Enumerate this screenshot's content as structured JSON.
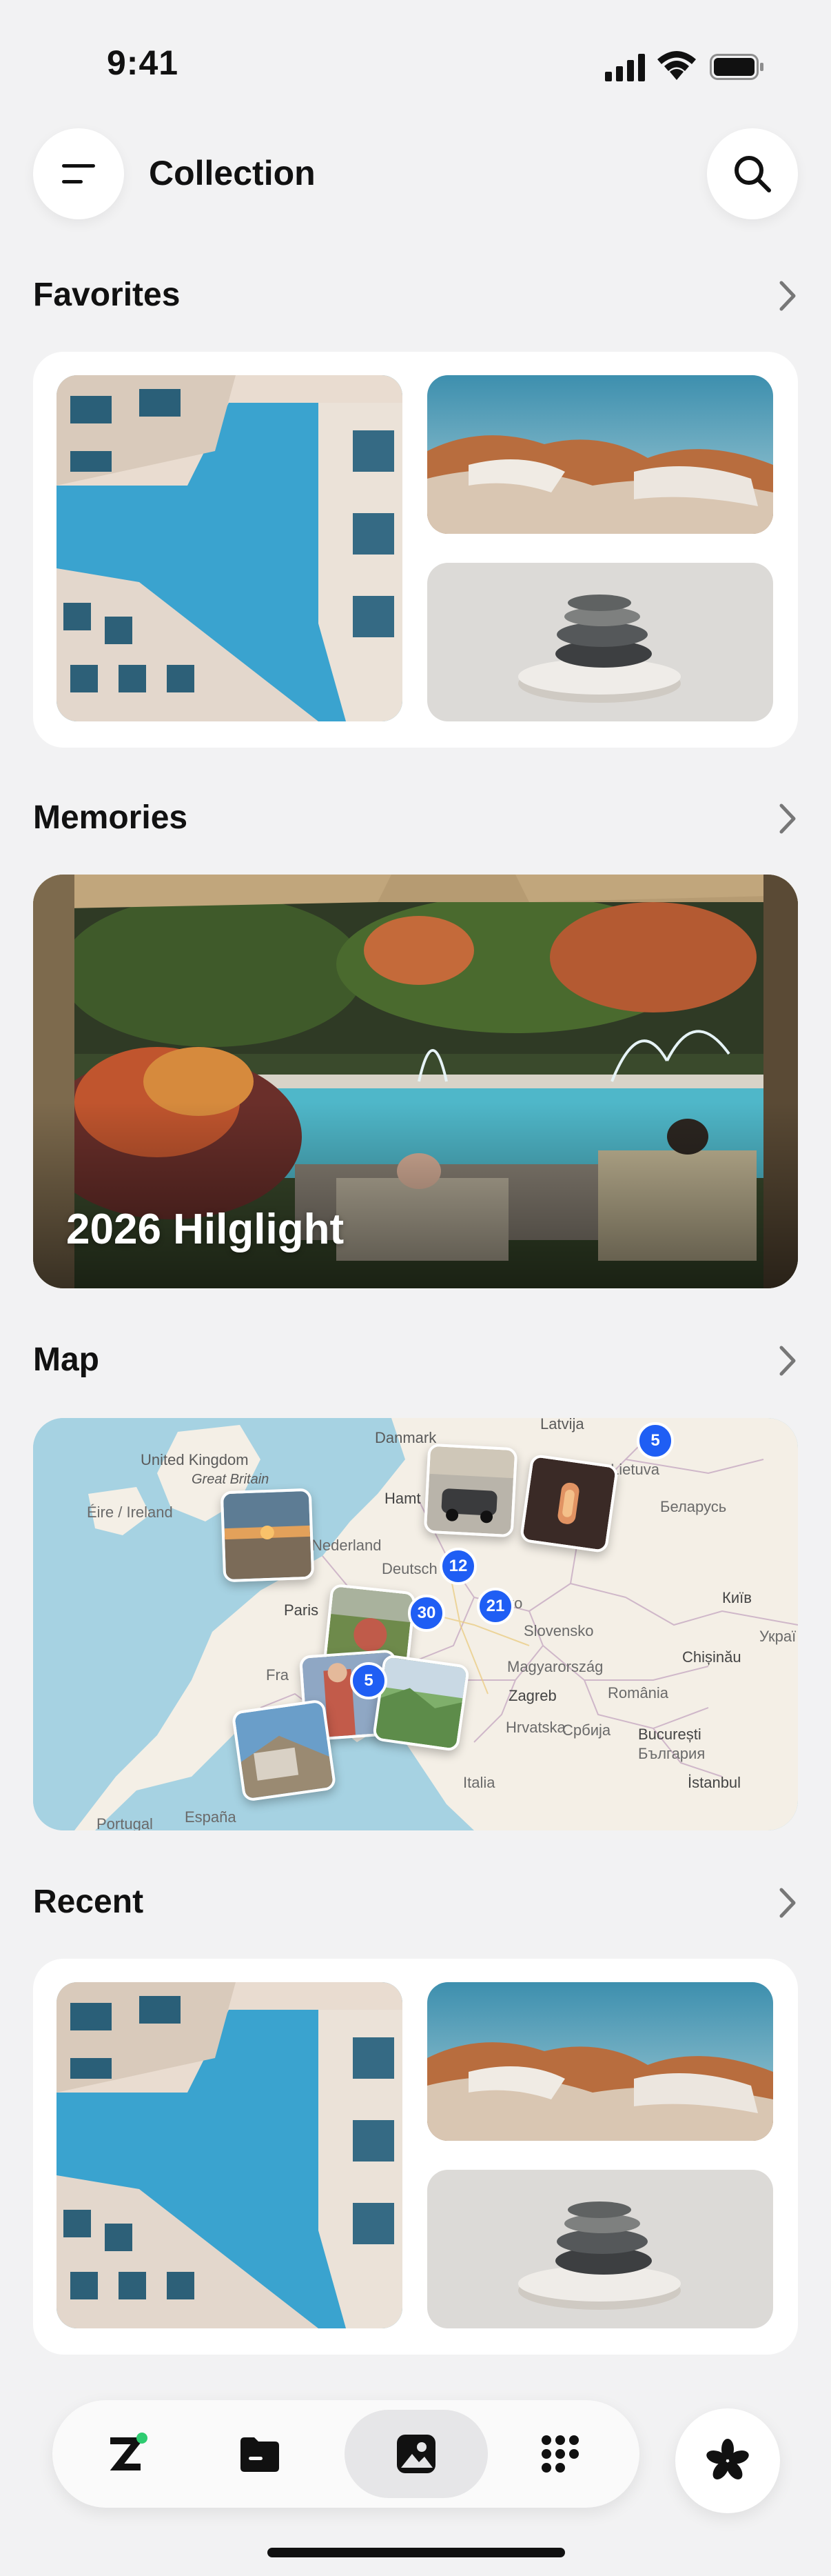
{
  "status_bar": {
    "time": "9:41"
  },
  "header": {
    "title": "Collection",
    "menu_icon": "menu-icon",
    "search_icon": "search-icon"
  },
  "sections": {
    "favorites": {
      "title": "Favorites"
    },
    "memories": {
      "title": "Memories",
      "card_title": "2026 Hilglight"
    },
    "map": {
      "title": "Map"
    },
    "recent": {
      "title": "Recent"
    }
  },
  "map": {
    "labels": {
      "latvija": "Latvija",
      "danmark": "Danmark",
      "uk": "United Kingdom",
      "great_britain": "Great Britain",
      "eire": "Éire / Ireland",
      "hamt": "Hamt",
      "nederland": "Nederland",
      "lietuva": "Lietuva",
      "belarus": "Беларусь",
      "deutsch": "Deutsch",
      "paris": "Paris",
      "cesko": "Česko",
      "kyiv": "Київ",
      "slovensko": "Slovensko",
      "ukra": "Украї",
      "fra": "Fra",
      "chisinau": "Chișinău",
      "magyarorszag": "Magyarország",
      "zagreb": "Zagreb",
      "romania": "România",
      "hrvatska": "Hrvatska",
      "srbija": "Србија",
      "bucuresti": "București",
      "bulgaria": "България",
      "italia": "Italia",
      "istanbul": "İstanbul",
      "espana": "España",
      "portugal": "Portugal"
    },
    "clusters": {
      "latvija": "5",
      "germany": "12",
      "france": "30",
      "austria": "21",
      "italy": "5"
    }
  },
  "nav": {
    "items": [
      {
        "name": "Z",
        "icon": "brand-icon"
      },
      {
        "name": "files",
        "icon": "folder-icon"
      },
      {
        "name": "photos",
        "icon": "photo-icon",
        "active": true
      },
      {
        "name": "apps",
        "icon": "grid-icon"
      }
    ],
    "fab_icon": "asterisk-icon"
  },
  "colors": {
    "accent": "#1f5ef4",
    "badge_green": "#2ecc71",
    "background": "#f2f2f3"
  }
}
